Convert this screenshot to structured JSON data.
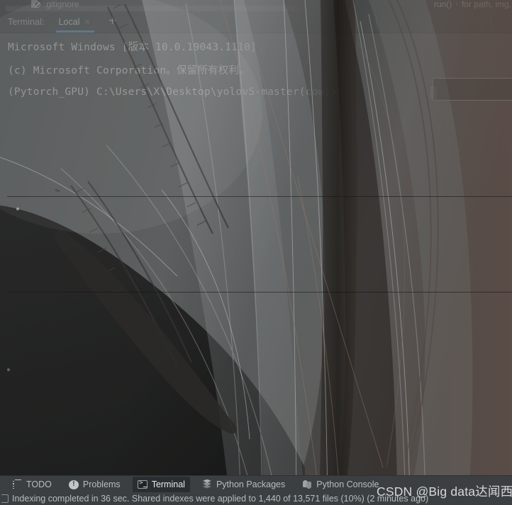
{
  "window": {
    "theme_bg": "#3c3f41",
    "accent": "#4e85c0"
  },
  "editor_tabstrip": {
    "tab_label": ".gitignore",
    "tab_icon": "gitignore-file-icon"
  },
  "breadcrumb": {
    "item1": "run()",
    "separator": "›",
    "item2": "for path, img,"
  },
  "terminal_panel": {
    "title": "Terminal:",
    "tab_label": "Local",
    "close_label": "×",
    "add_label": "+",
    "lines": [
      "Microsoft Windows [版本 10.0.19043.1110]",
      "(c) Microsoft Corporation。保留所有权利。",
      "(Pytorch_GPU) C:\\Users\\X\\Desktop\\yolov5-master(cow)>"
    ]
  },
  "bottom_toolwindows": {
    "items": [
      {
        "label": "TODO",
        "icon": "todo-icon",
        "active": false
      },
      {
        "label": "Problems",
        "icon": "problems-icon",
        "active": false
      },
      {
        "label": "Terminal",
        "icon": "terminal-icon",
        "active": true
      },
      {
        "label": "Python Packages",
        "icon": "python-packages-icon",
        "active": false
      },
      {
        "label": "Python Console",
        "icon": "python-console-icon",
        "active": false
      }
    ]
  },
  "statusbar": {
    "icon": "index-icon",
    "message": "Indexing completed in 36 sec. Shared indexes were applied to 1,440 of 13,571 files (10%) (2 minutes ago)"
  },
  "watermark": {
    "text": "CSDN @Big data达闻西"
  }
}
